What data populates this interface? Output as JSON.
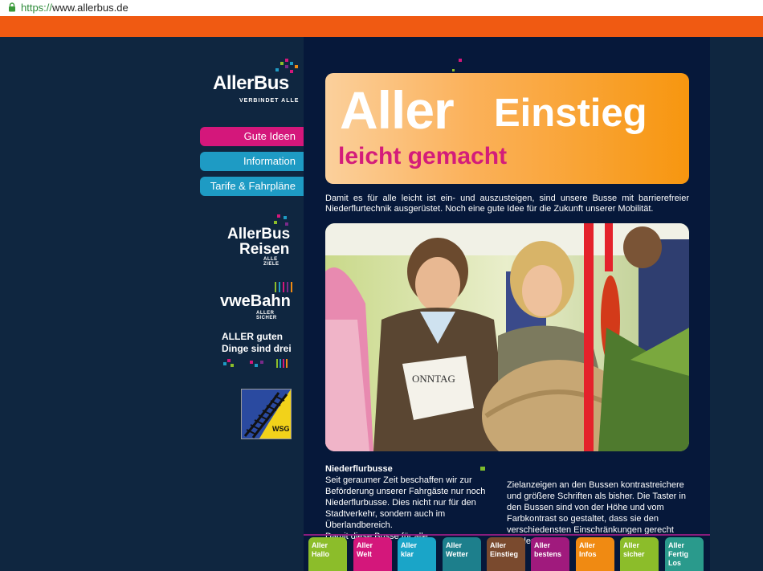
{
  "browser": {
    "scheme": "https://",
    "host": "www.allerbus.de"
  },
  "logo": {
    "name": "AllerBus",
    "tagline": "VERBINDET ALLE"
  },
  "nav": [
    {
      "label": "Gute Ideen",
      "color": "#d4177b"
    },
    {
      "label": "Information",
      "color": "#1e9bc4"
    },
    {
      "label": "Tarife & Fahrpläne",
      "color": "#1e9bc4"
    }
  ],
  "brands": {
    "reisen": {
      "line1": "AllerBus",
      "line2": "Reisen",
      "tag": "ALLE ZIELE"
    },
    "bahn": {
      "name": "vweBahn",
      "tag": "ALLER SICHER"
    },
    "three": {
      "line1": "ALLER guten",
      "line2": "Dinge sind drei"
    },
    "wsg": "WSG"
  },
  "hero": {
    "word1": "Aller",
    "word2": "Einstieg",
    "subtitle": "leicht gemacht"
  },
  "intro": "Damit es für alle leicht ist ein- und auszusteigen, sind unsere Busse mit barrierefreier Niederflurtechnik ausgerüstet. Noch eine gute Idee für die Zukunft unserer Mobilität.",
  "photo": {
    "newspaper": "ONNTAG"
  },
  "article": {
    "title": "Niederflurbusse",
    "left": "Seit geraumer Zeit beschaffen wir zur Beförderung unserer Fahrgäste nur noch Niederflurbusse. Dies nicht nur für den Stadtverkehr, sondern auch im Überlandbereich.",
    "left_cut": "Damit diese Busse für alle",
    "right": "Zielanzeigen an den Bussen kontrastreichere und größere Schriften als bisher. Die Taster in den Bussen sind von der Höhe und vom Farbkontrast so gestaltet, dass sie den verschiedensten Einschränkungen gerecht",
    "right_cut": "werden."
  },
  "tiles": [
    {
      "l1": "Aller",
      "l2": "Hallo",
      "l3": "",
      "color": "#8cbd2a"
    },
    {
      "l1": "Aller",
      "l2": "Welt",
      "l3": "",
      "color": "#d4177b"
    },
    {
      "l1": "Aller",
      "l2": "klar",
      "l3": "",
      "color": "#1aa5c8"
    },
    {
      "l1": "Aller",
      "l2": "Wetter",
      "l3": "",
      "color": "#1d7f8c"
    },
    {
      "l1": "Aller",
      "l2": "Einstieg",
      "l3": "",
      "color": "#7a4a2e"
    },
    {
      "l1": "Aller",
      "l2": "bestens",
      "l3": "",
      "color": "#a01a7d"
    },
    {
      "l1": "Aller",
      "l2": "Infos",
      "l3": "",
      "color": "#f08a12"
    },
    {
      "l1": "Aller",
      "l2": "sicher",
      "l3": "",
      "color": "#8cbd2a"
    },
    {
      "l1": "Aller",
      "l2": "Fertig",
      "l3": "Los",
      "color": "#2a9a8c"
    }
  ]
}
